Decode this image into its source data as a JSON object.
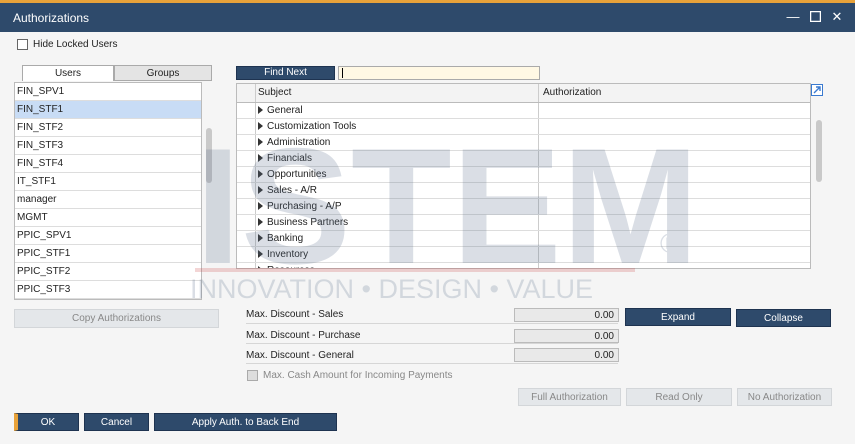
{
  "window": {
    "title": "Authorizations"
  },
  "options": {
    "hide_locked_users": "Hide Locked Users"
  },
  "tabs": {
    "users": "Users",
    "groups": "Groups"
  },
  "users": [
    "FIN_SPV1",
    "FIN_STF1",
    "FIN_STF2",
    "FIN_STF3",
    "FIN_STF4",
    "IT_STF1",
    "manager",
    "MGMT",
    "PPIC_SPV1",
    "PPIC_STF1",
    "PPIC_STF2",
    "PPIC_STF3"
  ],
  "find": {
    "button": "Find Next",
    "value": ""
  },
  "table": {
    "headers": {
      "subject": "Subject",
      "authorization": "Authorization"
    },
    "rows": [
      "General",
      "Customization Tools",
      "Administration",
      "Financials",
      "Opportunities",
      "Sales - A/R",
      "Purchasing - A/P",
      "Business Partners",
      "Banking",
      "Inventory",
      "Resources"
    ]
  },
  "copy_button": "Copy Authorizations",
  "discounts": {
    "sales": {
      "label": "Max. Discount - Sales",
      "value": "0.00"
    },
    "purchase": {
      "label": "Max. Discount - Purchase",
      "value": "0.00"
    },
    "general": {
      "label": "Max. Discount - General",
      "value": "0.00"
    }
  },
  "expand": "Expand",
  "collapse": "Collapse",
  "cash": "Max. Cash Amount for Incoming Payments",
  "auth_buttons": {
    "full": "Full Authorization",
    "read": "Read Only",
    "none": "No Authorization"
  },
  "footer": {
    "ok": "OK",
    "cancel": "Cancel",
    "apply": "Apply Auth. to Back End"
  },
  "watermark": {
    "brand": "ISTEM",
    "tagline": "INNOVATION • DESIGN • VALUE",
    "registered": "®"
  },
  "colors": {
    "titlebar": "#2e4a6b",
    "accent": "#e8a23a",
    "selection": "#c8dcf5"
  }
}
